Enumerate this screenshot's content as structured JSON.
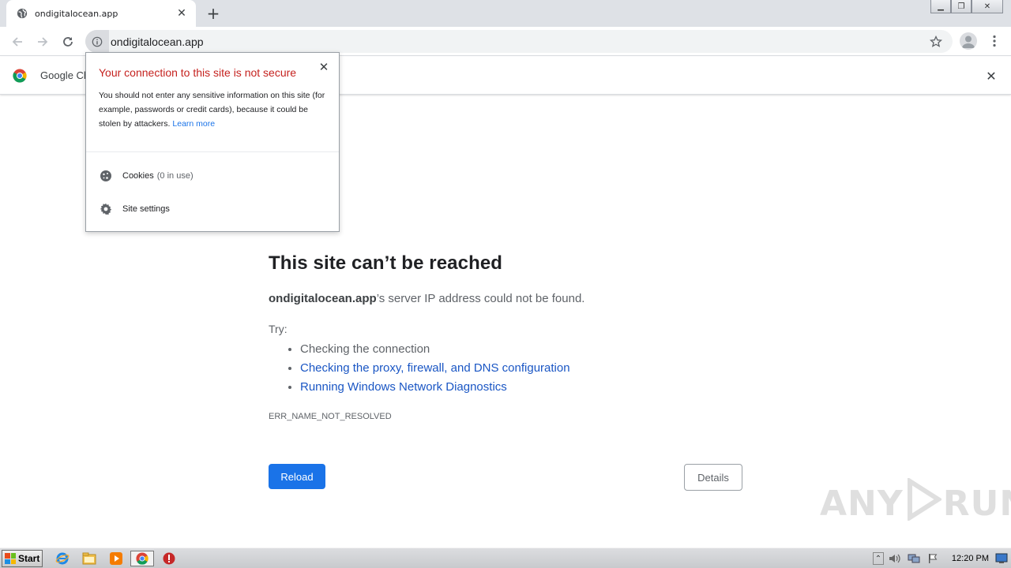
{
  "tab": {
    "title": "ondigitalocean.app"
  },
  "omnibox": {
    "url": "ondigitalocean.app"
  },
  "infobar": {
    "text": "Google Ch"
  },
  "popup": {
    "title": "Your connection to this site is not secure",
    "description": "You should not enter any sensitive information on this site (for example, passwords or credit cards), because it could be stolen by attackers.",
    "learn_more": "Learn more",
    "cookies_label": "Cookies",
    "cookies_count": "(0 in use)",
    "site_settings": "Site settings"
  },
  "error": {
    "heading": "This site can’t be reached",
    "domain": "ondigitalocean.app",
    "summary_rest": "’s server IP address could not be found.",
    "try_label": "Try:",
    "suggestions": [
      {
        "text": "Checking the connection",
        "link": false
      },
      {
        "text": "Checking the proxy, firewall, and DNS configuration",
        "link": true
      },
      {
        "text": "Running Windows Network Diagnostics",
        "link": true
      }
    ],
    "code": "ERR_NAME_NOT_RESOLVED",
    "reload_label": "Reload",
    "details_label": "Details"
  },
  "watermark": {
    "left": "ANY",
    "right": "RUN"
  },
  "taskbar": {
    "start_label": "Start",
    "clock": "12:20 PM"
  },
  "colors": {
    "accent": "#1a73e8",
    "insecure": "#c5221f",
    "link": "#1a56c4"
  },
  "icons": [
    "globe-icon",
    "close-icon",
    "plus-icon",
    "back-arrow-icon",
    "forward-arrow-icon",
    "reload-icon",
    "info-icon",
    "star-icon",
    "profile-icon",
    "kebab-menu-icon",
    "chrome-logo-icon",
    "cookie-icon",
    "gear-icon"
  ]
}
